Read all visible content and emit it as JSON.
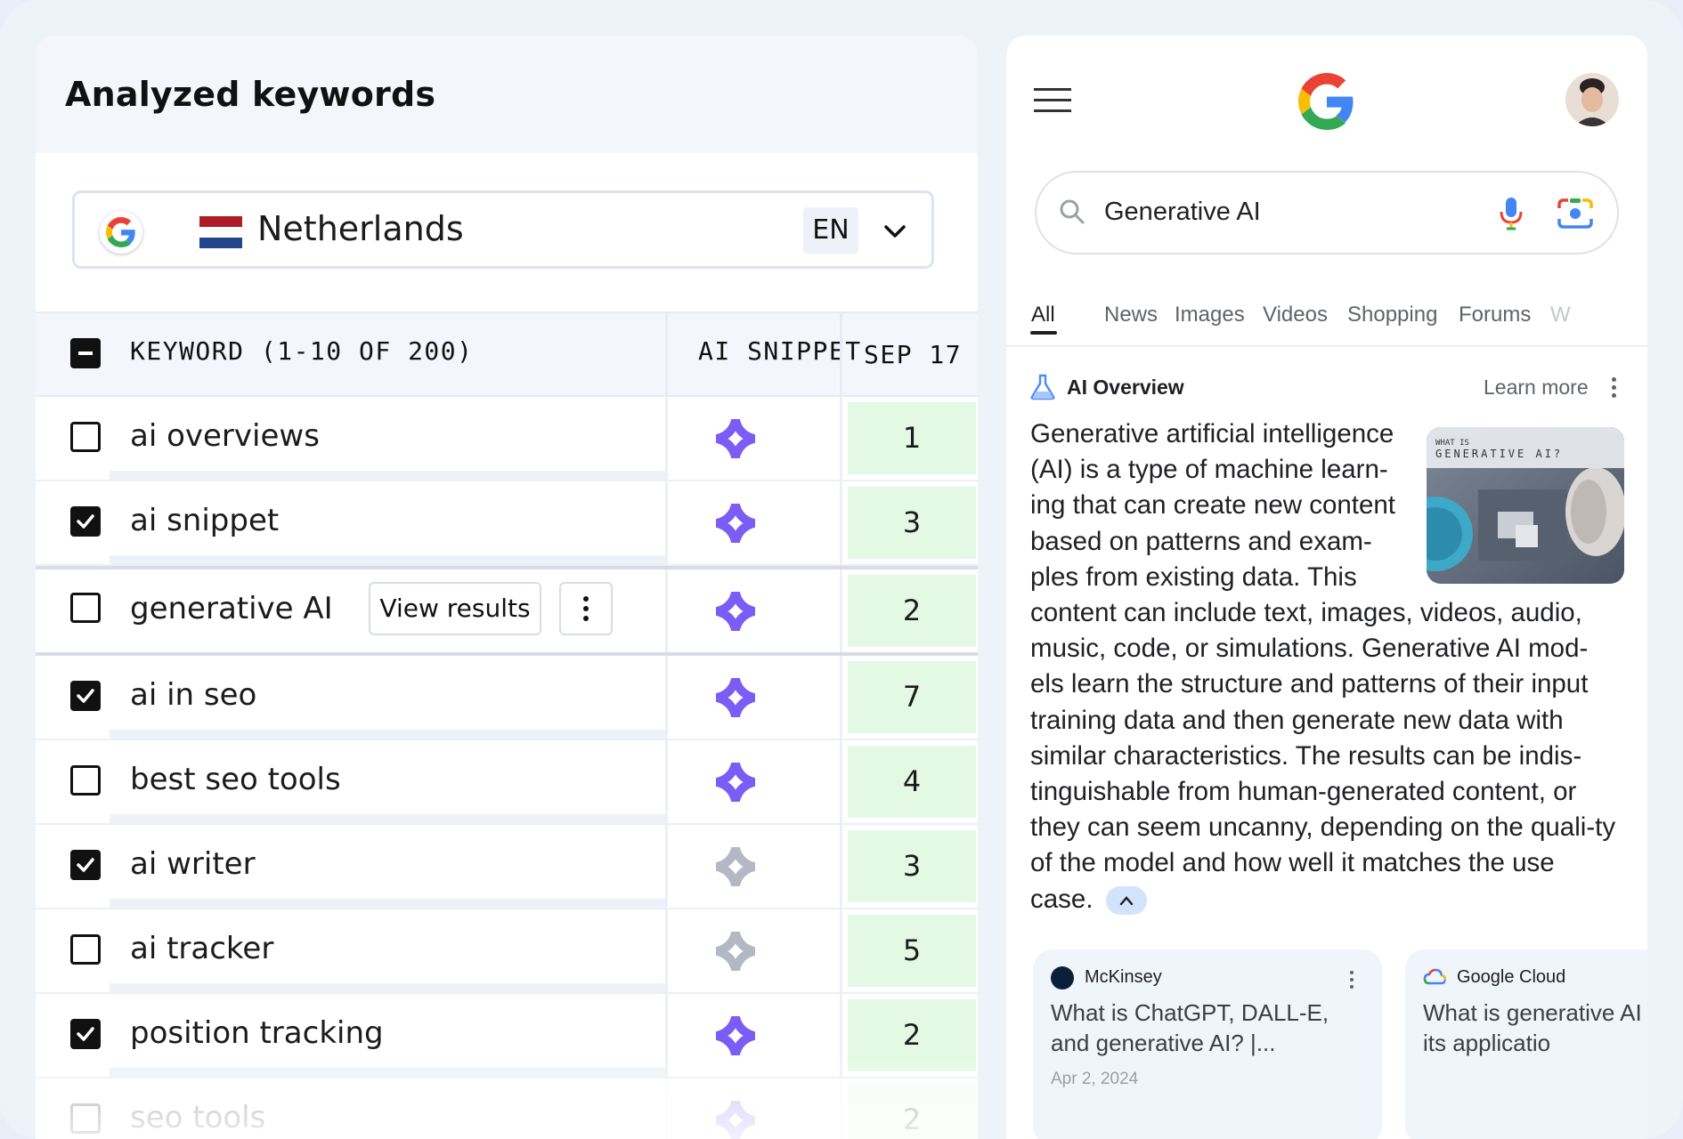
{
  "left_panel": {
    "title": "Analyzed keywords",
    "country": {
      "name": "Netherlands",
      "language": "EN",
      "flag_colors": [
        "#ae1c28",
        "#ffffff",
        "#21468b"
      ]
    },
    "table": {
      "headers": {
        "keyword": "KEYWORD (1-10 OF 200)",
        "ai_snippet": "AI SNIPPET",
        "date": "SEP 17"
      },
      "rows": [
        {
          "keyword": "ai overviews",
          "checked": false,
          "ai_snippet": true,
          "position": "1"
        },
        {
          "keyword": "ai snippet",
          "checked": true,
          "ai_snippet": true,
          "position": "3"
        },
        {
          "keyword": "generative AI",
          "checked": false,
          "ai_snippet": true,
          "position": "2",
          "hovered": true
        },
        {
          "keyword": "ai in seo",
          "checked": true,
          "ai_snippet": true,
          "position": "7"
        },
        {
          "keyword": "best seo tools",
          "checked": false,
          "ai_snippet": true,
          "position": "4"
        },
        {
          "keyword": "ai writer",
          "checked": true,
          "ai_snippet": false,
          "position": "3"
        },
        {
          "keyword": "ai tracker",
          "checked": false,
          "ai_snippet": false,
          "position": "5"
        },
        {
          "keyword": "position tracking",
          "checked": true,
          "ai_snippet": true,
          "position": "2"
        },
        {
          "keyword": "seo tools",
          "checked": false,
          "ai_snippet": true,
          "position": "2"
        }
      ],
      "view_results_label": "View results"
    },
    "colors": {
      "spark_active": "#7b5cf5",
      "spark_inactive": "#b3b8c4",
      "position_bg": "#e3f9e3"
    }
  },
  "google_panel": {
    "search_query": "Generative AI",
    "tabs": [
      "All",
      "News",
      "Images",
      "Videos",
      "Shopping",
      "Forums",
      "W"
    ],
    "active_tab": "All",
    "ai_overview": {
      "title": "AI Overview",
      "learn_more": "Learn more",
      "text": "Generative artificial intelligence (AI) is a type of machine learn-ing that can create new content based on patterns and exam-ples from existing data. This content can include text, images, videos, audio, music, code, or simulations. Generative AI mod-els learn the structure and patterns of their input training data and then generate new data with similar characteristics. The results can be indis-tinguishable from human-generated content, or they can seem uncanny, depending on the quali-ty of the model and how well it matches the use case.",
      "thumbnail_heading_1": "WHAT IS",
      "thumbnail_heading_2": "GENERATIVE AI?"
    },
    "sources": [
      {
        "name": "McKinsey",
        "title": "What is ChatGPT, DALL-E, and generative AI? |...",
        "date": "Apr 2, 2024"
      },
      {
        "name": "Google Cloud",
        "title": "What is generative AI what are its applicatio",
        "date": ""
      }
    ]
  }
}
